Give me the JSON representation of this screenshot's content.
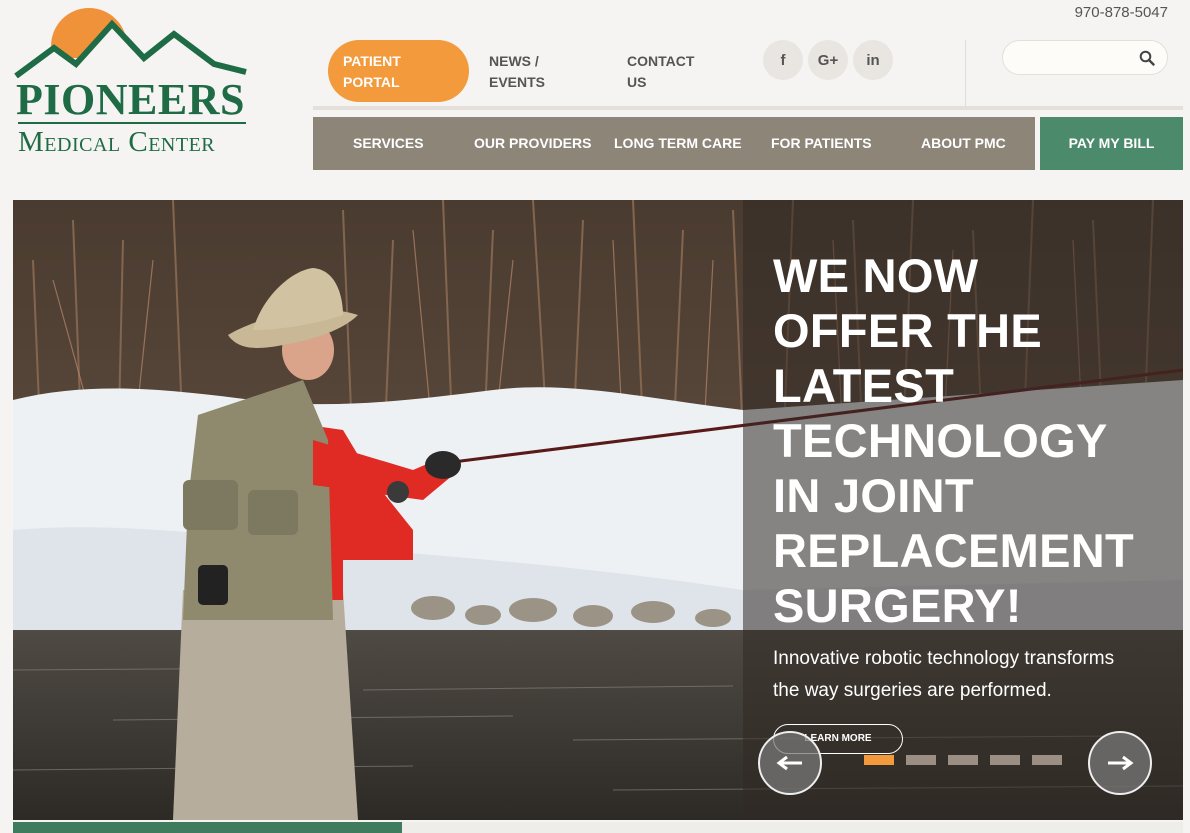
{
  "logo": {
    "line1": "PIONEERS",
    "line2": "Medical Center"
  },
  "header": {
    "phone": "970-878-5047"
  },
  "top_nav": {
    "patient_portal": [
      "PATIENT",
      "PORTAL"
    ],
    "news_events": [
      "NEWS /",
      "EVENTS"
    ],
    "contact_us": [
      "CONTACT",
      "US"
    ]
  },
  "social": {
    "facebook": "f",
    "google_plus": "G+",
    "linkedin": "in"
  },
  "search": {
    "placeholder": "",
    "icon": "search-icon"
  },
  "main_nav": {
    "items": [
      "SERVICES",
      "OUR PROVIDERS",
      "LONG TERM CARE",
      "FOR PATIENTS",
      "ABOUT PMC"
    ],
    "pay_bill": "PAY MY BILL"
  },
  "hero": {
    "title_lines": [
      "WE NOW",
      "OFFER THE",
      "LATEST",
      "TECHNOLOGY",
      "IN JOINT",
      "REPLACEMENT",
      "SURGERY!"
    ],
    "subtitle_lines": [
      "Innovative robotic technology transforms",
      "the way surgeries are performed."
    ],
    "cta": "LEARN MORE",
    "slides": 5,
    "active_slide": 1
  },
  "colors": {
    "brand_green": "#1f6b45",
    "orange": "#f39a3c",
    "nav_taupe": "#8e8579",
    "pay_green": "#4b8a6a"
  }
}
